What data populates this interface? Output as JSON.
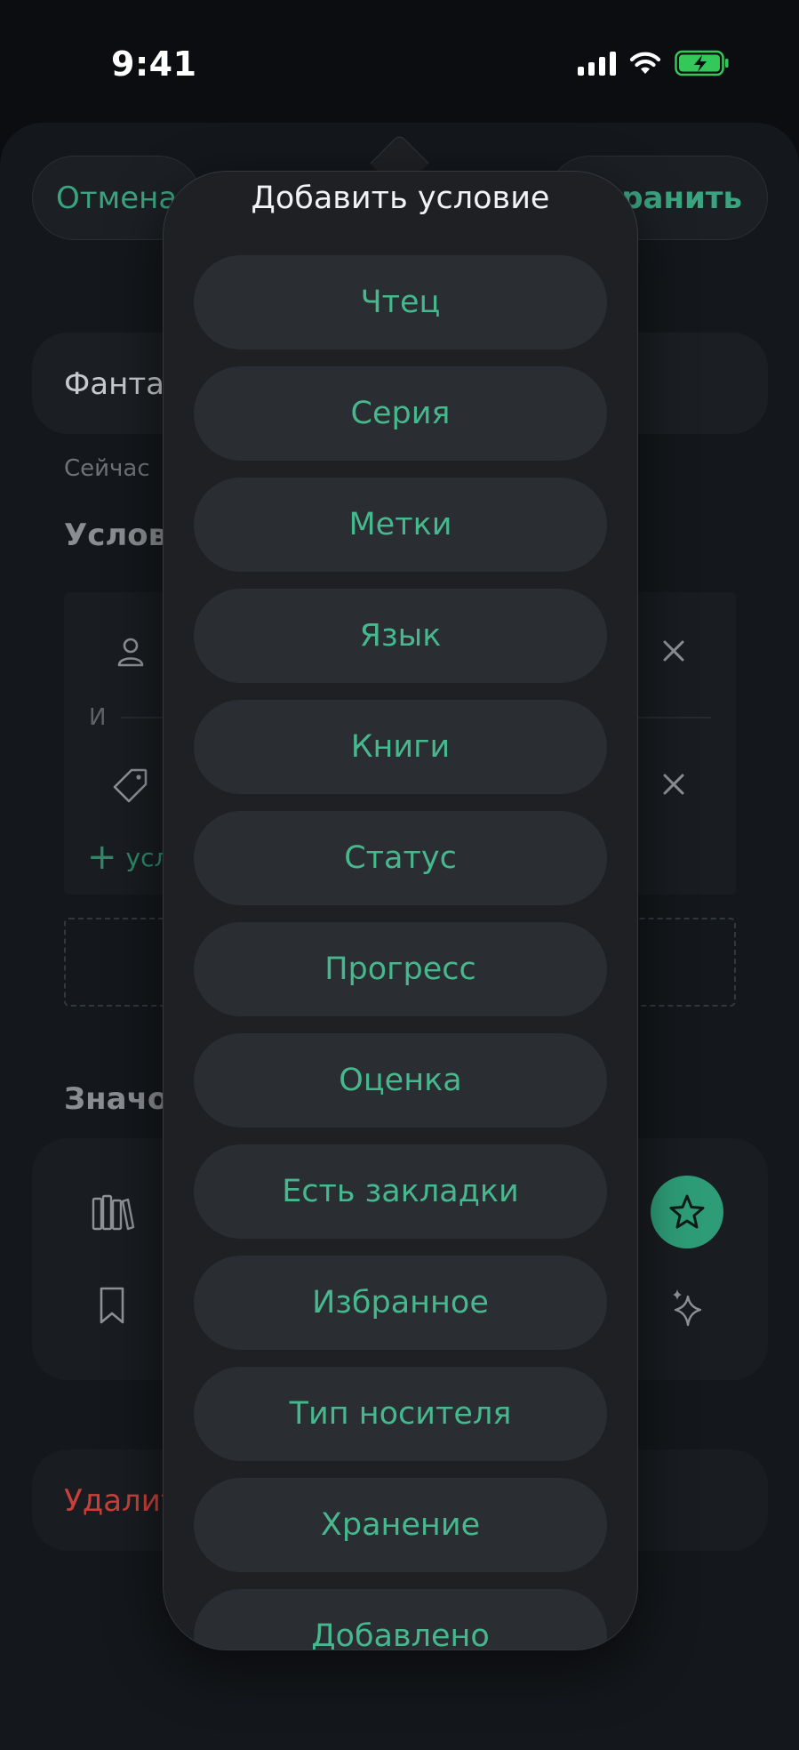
{
  "status_bar": {
    "time": "9:41"
  },
  "header": {
    "cancel_label": "Отмена",
    "save_label": "Сохранить"
  },
  "form": {
    "name_value": "Фантастика",
    "hint": "Сейчас",
    "conditions_title": "Условия",
    "and_label": "И",
    "add_condition_label": "условие",
    "icons_title": "Значок",
    "delete_label": "Удалить"
  },
  "popover": {
    "title": "Добавить условие",
    "options": [
      "Чтец",
      "Серия",
      "Метки",
      "Язык",
      "Книги",
      "Статус",
      "Прогресс",
      "Оценка",
      "Есть закладки",
      "Избранное",
      "Тип носителя",
      "Хранение",
      "Добавлено"
    ]
  },
  "colors": {
    "accent": "#47b88d",
    "destructive": "#c9403a",
    "battery_charging": "#34c759"
  },
  "icons": {
    "signal": "cellular-signal-icon",
    "wifi": "wifi-icon",
    "battery": "battery-charging-icon",
    "person": "person-icon",
    "tag": "tag-icon",
    "close": "close-icon",
    "plus": "plus-icon",
    "books": "books-icon",
    "bookmark": "bookmark-icon",
    "star": "star-icon",
    "sparkles": "sparkles-icon"
  }
}
